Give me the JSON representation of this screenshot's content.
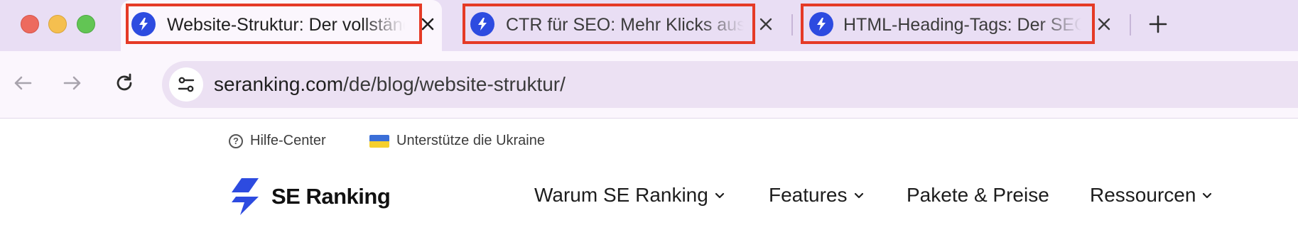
{
  "tabs": [
    {
      "title": "Website-Struktur: Der vollständige Leitfaden",
      "active": true,
      "highlighted": true,
      "favicon": "se-ranking-icon"
    },
    {
      "title": "CTR für SEO: Mehr Klicks aus Google holen",
      "active": false,
      "highlighted": true,
      "favicon": "se-ranking-icon"
    },
    {
      "title": "HTML-Heading-Tags: Der SEO-Guide",
      "active": false,
      "highlighted": true,
      "favicon": "se-ranking-icon"
    }
  ],
  "toolbar": {
    "url_domain": "seranking.com",
    "url_path": "/de/blog/website-struktur/"
  },
  "page": {
    "top_links": {
      "help": "Hilfe-Center",
      "ukraine": "Unterstütze die Ukraine"
    },
    "logo_text": "SE Ranking",
    "nav": {
      "why": "Warum SE Ranking",
      "features": "Features",
      "pricing": "Pakete & Preise",
      "resources": "Ressourcen"
    }
  },
  "colors": {
    "highlight_border": "#e53a26",
    "brand_blue": "#2d4be0",
    "tabstrip_bg": "#e9def4"
  }
}
